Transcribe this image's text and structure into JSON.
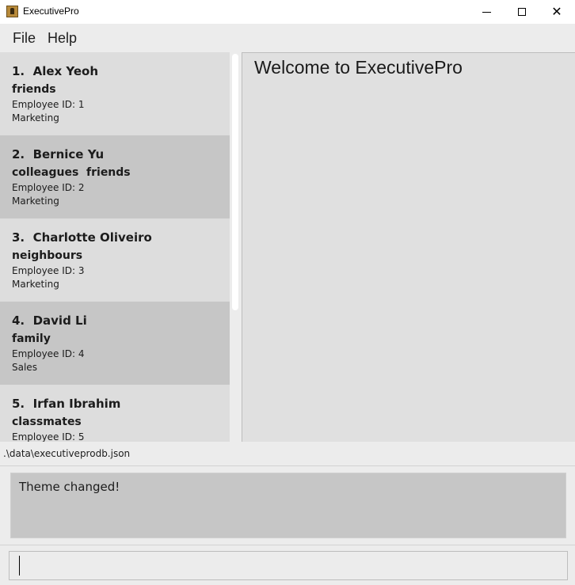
{
  "window": {
    "title": "ExecutivePro"
  },
  "menu": {
    "file": "File",
    "help": "Help"
  },
  "employees": [
    {
      "name": "1.  Alex Yeoh",
      "tags": "friends",
      "employee_id": "Employee ID: 1",
      "department": "Marketing"
    },
    {
      "name": "2.  Bernice Yu",
      "tags": "colleagues  friends",
      "employee_id": "Employee ID: 2",
      "department": "Marketing"
    },
    {
      "name": "3.  Charlotte Oliveiro",
      "tags": "neighbours",
      "employee_id": "Employee ID: 3",
      "department": "Marketing"
    },
    {
      "name": "4.  David Li",
      "tags": "family",
      "employee_id": "Employee ID: 4",
      "department": "Sales"
    },
    {
      "name": "5.  Irfan Ibrahim",
      "tags": "classmates",
      "employee_id": "Employee ID: 5",
      "department": ""
    }
  ],
  "details": {
    "welcome": "Welcome to ExecutivePro"
  },
  "status": {
    "file_path": ".\\data\\executiveprodb.json"
  },
  "result": {
    "message": "Theme changed!"
  },
  "command": {
    "value": ""
  },
  "colors": {
    "card_light": "#dddddd",
    "card_dark": "#c6c6c6",
    "result_bg": "#c6c6c6"
  },
  "icons": {
    "app": "app-icon",
    "minimize": "minimize-icon",
    "maximize": "maximize-icon",
    "close": "close-icon"
  }
}
